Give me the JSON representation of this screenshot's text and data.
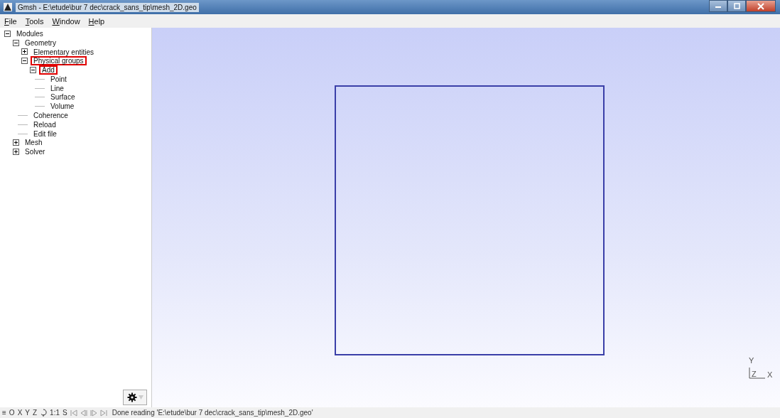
{
  "window": {
    "title": "Gmsh - E:\\etude\\bur 7 dec\\crack_sans_tip\\mesh_2D.geo"
  },
  "menu": [
    {
      "label": "File"
    },
    {
      "label": "Tools"
    },
    {
      "label": "Window"
    },
    {
      "label": "Help"
    }
  ],
  "tree": [
    {
      "label": "Modules",
      "expanded": true,
      "highlighted": false,
      "children": [
        {
          "label": "Geometry",
          "expanded": true,
          "highlighted": false,
          "children": [
            {
              "label": "Elementary entities",
              "expanded": false,
              "highlighted": false
            },
            {
              "label": "Physical groups",
              "expanded": true,
              "highlighted": true,
              "children": [
                {
                  "label": "Add",
                  "expanded": true,
                  "highlighted": true,
                  "children": [
                    {
                      "label": "Point",
                      "highlighted": false
                    },
                    {
                      "label": "Line",
                      "highlighted": false
                    },
                    {
                      "label": "Surface",
                      "highlighted": false
                    },
                    {
                      "label": "Volume",
                      "highlighted": false
                    }
                  ]
                }
              ]
            },
            {
              "label": "Coherence",
              "highlighted": false
            },
            {
              "label": "Reload",
              "highlighted": false
            },
            {
              "label": "Edit file",
              "highlighted": false
            }
          ]
        },
        {
          "label": "Mesh",
          "expanded": false,
          "highlighted": false
        },
        {
          "label": "Solver",
          "expanded": false,
          "highlighted": false
        }
      ]
    }
  ],
  "axes": {
    "y": "Y",
    "z": "Z",
    "x": "X"
  },
  "status_bar": {
    "buttons": [
      "≡",
      "O",
      "X",
      "Y",
      "Z",
      "1:1",
      "S"
    ],
    "message": "Done reading 'E:\\etude\\bur 7 dec\\crack_sans_tip\\mesh_2D.geo'"
  }
}
